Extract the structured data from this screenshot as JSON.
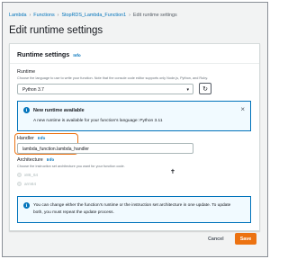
{
  "breadcrumb": {
    "items": [
      "Lambda",
      "Functions",
      "StopRDS_Lambda_Function1"
    ],
    "current": "Edit runtime settings"
  },
  "page": {
    "title": "Edit runtime settings"
  },
  "panel": {
    "title": "Runtime settings",
    "info_label": "Info",
    "runtime": {
      "label": "Runtime",
      "description": "Choose the language to use to write your function. Note that the console code editor supports only Node.js, Python, and Ruby.",
      "value": "Python 3.7"
    },
    "alert": {
      "title": "New runtime available",
      "text": "A new runtime is available for your function's language: Python 3.11"
    },
    "handler": {
      "label": "Handler",
      "info_label": "Info",
      "value": "lambda_function.lambda_handler"
    },
    "architecture": {
      "label": "Architecture",
      "info_label": "Info",
      "description": "Choose the instruction set architecture you want for your function code.",
      "options": [
        "x86_64",
        "arm64"
      ]
    },
    "note": {
      "line1": "You can change either the function's runtime or the instruction set architecture in one update. To update",
      "line2": "both, you must repeat the update process."
    }
  },
  "footer": {
    "cancel_label": "Cancel",
    "save_label": "Save"
  },
  "colors": {
    "link": "#0073bb",
    "accent": "#ec7211",
    "info_bg": "#f1faff"
  }
}
